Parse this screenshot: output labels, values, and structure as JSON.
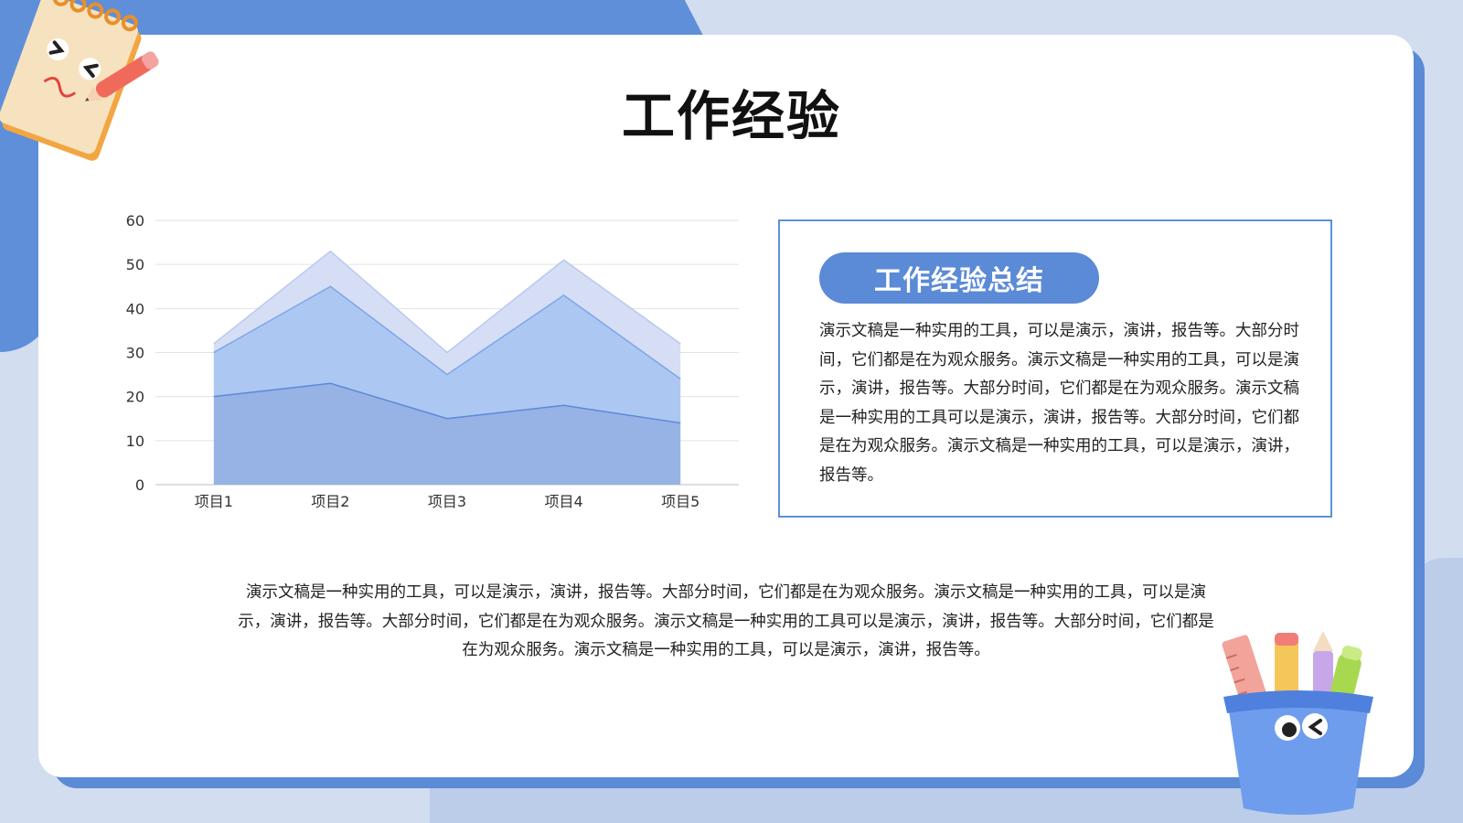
{
  "page": {
    "title": "工作经验"
  },
  "summary": {
    "heading": "工作经验总结",
    "body": "演示文稿是一种实用的工具，可以是演示，演讲，报告等。大部分时间，它们都是在为观众服务。演示文稿是一种实用的工具，可以是演示，演讲，报告等。大部分时间，它们都是在为观众服务。演示文稿是一种实用的工具可以是演示，演讲，报告等。大部分时间，它们都是在为观众服务。演示文稿是一种实用的工具，可以是演示，演讲，报告等。"
  },
  "footer_text": "演示文稿是一种实用的工具，可以是演示，演讲，报告等。大部分时间，它们都是在为观众服务。演示文稿是一种实用的工具，可以是演示，演讲，报告等。大部分时间，它们都是在为观众服务。演示文稿是一种实用的工具可以是演示，演讲，报告等。大部分时间，它们都是在为观众服务。演示文稿是一种实用的工具，可以是演示，演讲，报告等。",
  "colors": {
    "accent": "#5b8ad6",
    "series_1": "#97b2e5",
    "series_2": "#acc8f2",
    "series_3": "#d5def4",
    "line_1": "#5c88d8",
    "line_2": "#7ea5e8",
    "line_3": "#b9c9ee"
  },
  "decorations": [
    "notebook-pencil-sticker",
    "pen-cup-sticker"
  ],
  "chart_data": {
    "type": "area",
    "stacked": true,
    "categories": [
      "项目1",
      "项目2",
      "项目3",
      "项目4",
      "项目5"
    ],
    "series": [
      {
        "values": [
          20,
          23,
          15,
          18,
          14
        ]
      },
      {
        "values": [
          10,
          22,
          10,
          25,
          10
        ]
      },
      {
        "values": [
          2,
          8,
          5,
          8,
          8
        ]
      }
    ],
    "yticks": [
      0,
      10,
      20,
      30,
      40,
      50,
      60
    ],
    "ylim": [
      0,
      60
    ],
    "grid": true,
    "legend": "none",
    "title": "",
    "xlabel": "",
    "ylabel": ""
  }
}
